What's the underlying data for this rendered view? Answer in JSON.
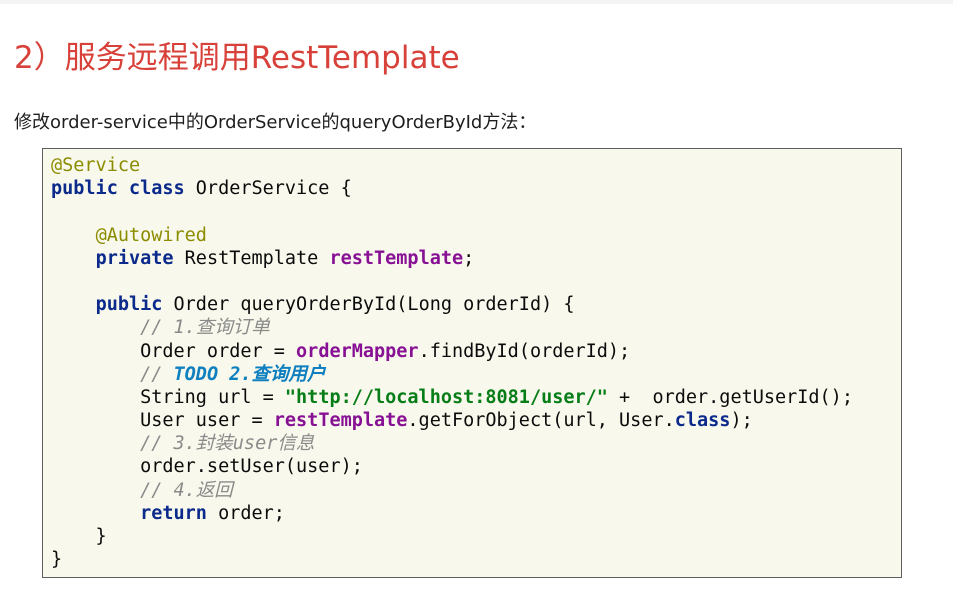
{
  "slide": {
    "title": "2）服务远程调用RestTemplate",
    "instruction": "修改order-service中的OrderService的queryOrderById方法："
  },
  "code": {
    "language": "java",
    "lines": [
      [
        {
          "t": "anno",
          "s": "@Service"
        }
      ],
      [
        {
          "t": "kw",
          "s": "public class"
        },
        {
          "t": "plain",
          "s": " OrderService {"
        }
      ],
      [],
      [
        {
          "t": "plain",
          "s": "    "
        },
        {
          "t": "anno",
          "s": "@Autowired"
        }
      ],
      [
        {
          "t": "plain",
          "s": "    "
        },
        {
          "t": "kw",
          "s": "private"
        },
        {
          "t": "plain",
          "s": " RestTemplate "
        },
        {
          "t": "field",
          "s": "restTemplate"
        },
        {
          "t": "plain",
          "s": ";"
        }
      ],
      [],
      [
        {
          "t": "plain",
          "s": "    "
        },
        {
          "t": "kw",
          "s": "public"
        },
        {
          "t": "plain",
          "s": " Order queryOrderById(Long orderId) {"
        }
      ],
      [
        {
          "t": "plain",
          "s": "        "
        },
        {
          "t": "comment",
          "s": "// 1.查询订单"
        }
      ],
      [
        {
          "t": "plain",
          "s": "        Order order = "
        },
        {
          "t": "field",
          "s": "orderMapper"
        },
        {
          "t": "plain",
          "s": ".findById(orderId);"
        }
      ],
      [
        {
          "t": "plain",
          "s": "        "
        },
        {
          "t": "comment",
          "s": "// "
        },
        {
          "t": "todo",
          "s": "TODO 2.查询用户"
        }
      ],
      [
        {
          "t": "plain",
          "s": "        String url = "
        },
        {
          "t": "str",
          "s": "\"http://localhost:8081/user/\""
        },
        {
          "t": "plain",
          "s": " +  order.getUserId();"
        }
      ],
      [
        {
          "t": "plain",
          "s": "        User user = "
        },
        {
          "t": "field",
          "s": "restTemplate"
        },
        {
          "t": "plain",
          "s": ".getForObject(url, User."
        },
        {
          "t": "kw",
          "s": "class"
        },
        {
          "t": "plain",
          "s": ");"
        }
      ],
      [
        {
          "t": "plain",
          "s": "        "
        },
        {
          "t": "comment",
          "s": "// 3.封装user信息"
        }
      ],
      [
        {
          "t": "plain",
          "s": "        order.setUser(user);"
        }
      ],
      [
        {
          "t": "plain",
          "s": "        "
        },
        {
          "t": "comment",
          "s": "// 4.返回"
        }
      ],
      [
        {
          "t": "plain",
          "s": "        "
        },
        {
          "t": "kw",
          "s": "return"
        },
        {
          "t": "plain",
          "s": " order;"
        }
      ],
      [
        {
          "t": "plain",
          "s": "    }"
        }
      ],
      [
        {
          "t": "plain",
          "s": "}"
        }
      ]
    ]
  },
  "colors": {
    "title": "#d8413a",
    "code_background": "#f8f8ec",
    "code_border": "#5f5f5f",
    "annotation": "#8c8c00",
    "keyword": "#0b2a8b",
    "field": "#871094",
    "string": "#067d17",
    "comment": "#8a8a8a",
    "todo": "#0e7fbf"
  }
}
